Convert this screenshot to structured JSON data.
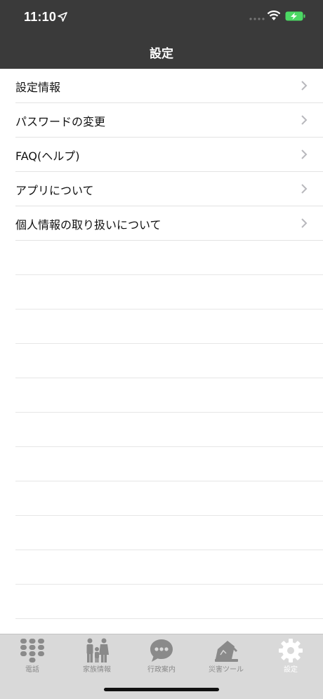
{
  "status_bar": {
    "time": "11:10",
    "location_icon": "location-arrow-icon",
    "wifi_icon": "wifi-icon",
    "battery_icon": "battery-charging-icon",
    "battery_color": "#4cd964"
  },
  "header": {
    "title": "設定",
    "background": "#3a3a3a"
  },
  "menu": {
    "items": [
      {
        "label": "設定情報"
      },
      {
        "label": "パスワードの変更"
      },
      {
        "label": "FAQ(ヘルプ)"
      },
      {
        "label": "アプリについて"
      },
      {
        "label": "個人情報の取り扱いについて"
      }
    ]
  },
  "tabbar": {
    "tabs": [
      {
        "label": "電話",
        "icon": "keypad-icon",
        "active": false
      },
      {
        "label": "家族情報",
        "icon": "family-icon",
        "active": false
      },
      {
        "label": "行政案内",
        "icon": "speech-bubble-icon",
        "active": false
      },
      {
        "label": "災害ツール",
        "icon": "collapsed-house-icon",
        "active": false
      },
      {
        "label": "設定",
        "icon": "gear-icon",
        "active": true
      }
    ]
  }
}
